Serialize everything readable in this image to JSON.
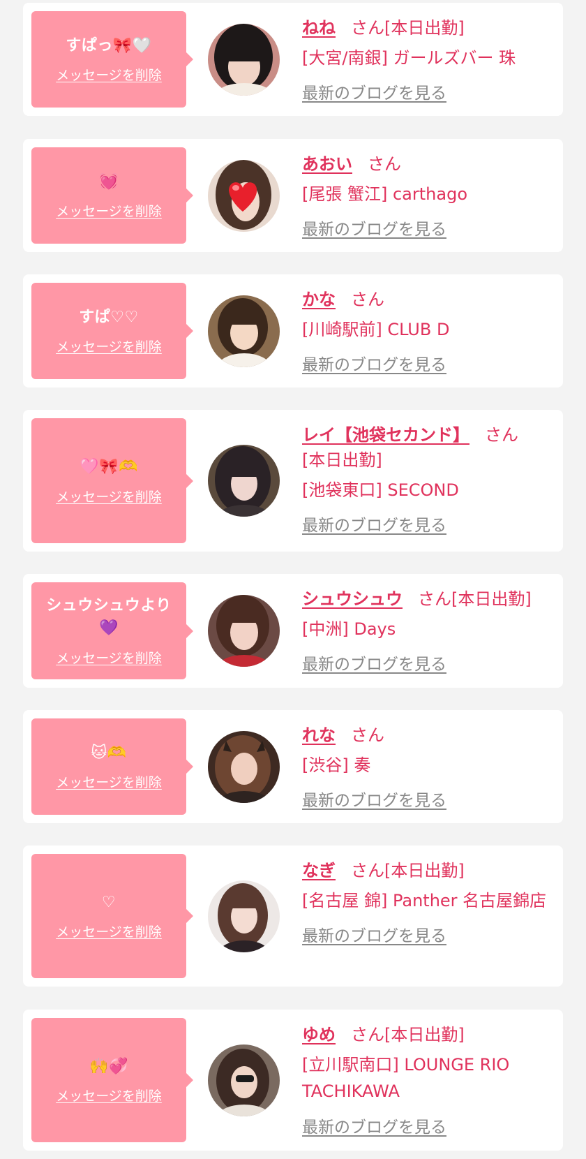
{
  "delete_label": "メッセージを削除",
  "blog_label": "最新のブログを見る",
  "san_label": "さん",
  "colors": {
    "background": "#f3f3f3",
    "bubble": "#ff97a6",
    "accent": "#e0325c",
    "muted": "#888888"
  },
  "messages": [
    {
      "message": "すぱっ🎀🤍",
      "name": "ねね",
      "tag": "[本日出勤]",
      "shop": "[大宮/南銀] ガールズバー 珠"
    },
    {
      "message": "💓",
      "name": "あおい",
      "tag": "",
      "shop": "[尾張 蟹江] carthago"
    },
    {
      "message": "すぱ♡♡",
      "name": "かな",
      "tag": "",
      "shop": "[川崎駅前] CLUB D"
    },
    {
      "message": "🩷🎀🫶",
      "name": "レイ【池袋セカンド】",
      "tag": "[本日出勤]",
      "shop": "[池袋東口] SECOND"
    },
    {
      "message": "シュウシュウより\n💜",
      "name": "シュウシュウ",
      "tag": "[本日出勤]",
      "shop": "[中洲] Days"
    },
    {
      "message": "🐱🫶",
      "name": "れな",
      "tag": "",
      "shop": "[渋谷] 奏"
    },
    {
      "message": "♡",
      "name": "なぎ",
      "tag": "[本日出勤]",
      "shop": "[名古屋 錦] Panther 名古屋錦店"
    },
    {
      "message": "🙌💞",
      "name": "ゆめ",
      "tag": "[本日出勤]",
      "shop": "[立川駅南口] LOUNGE RIO TACHIKAWA"
    }
  ]
}
